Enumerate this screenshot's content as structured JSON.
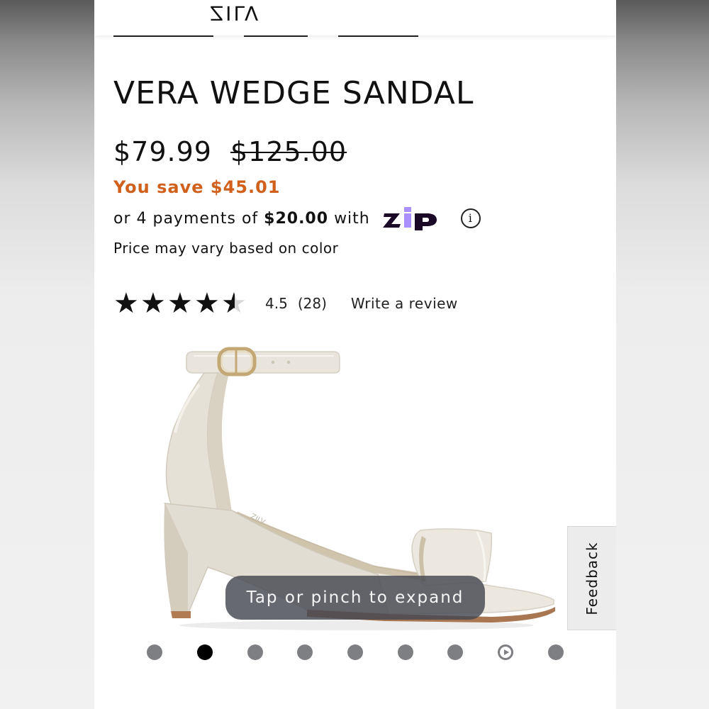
{
  "header": {
    "logo_text": "ZILV"
  },
  "product": {
    "title": "VERA WEDGE SANDAL",
    "sale_price": "$79.99",
    "original_price": "$125.00",
    "savings_text": "You save $45.01",
    "installments": {
      "prefix": "or 4 payments of",
      "amount": "$20.00",
      "suffix": "with",
      "provider": "zip",
      "info_icon": "ⓘ"
    },
    "price_note": "Price may vary based on color",
    "rating": {
      "value": "4.5",
      "count": "(28)",
      "stars": 4.5,
      "write_review_label": "Write a review"
    }
  },
  "gallery": {
    "expand_hint": "Tap or pinch to expand",
    "dot_count": 9,
    "active_index": 1,
    "video_index": 7
  },
  "feedback_label": "Feedback",
  "colors": {
    "savings": "#d0601c",
    "zip_text": "#1a0826",
    "zip_accent": "#aa8fff",
    "dot_inactive": "#7d7f82",
    "dot_active": "#000000"
  }
}
